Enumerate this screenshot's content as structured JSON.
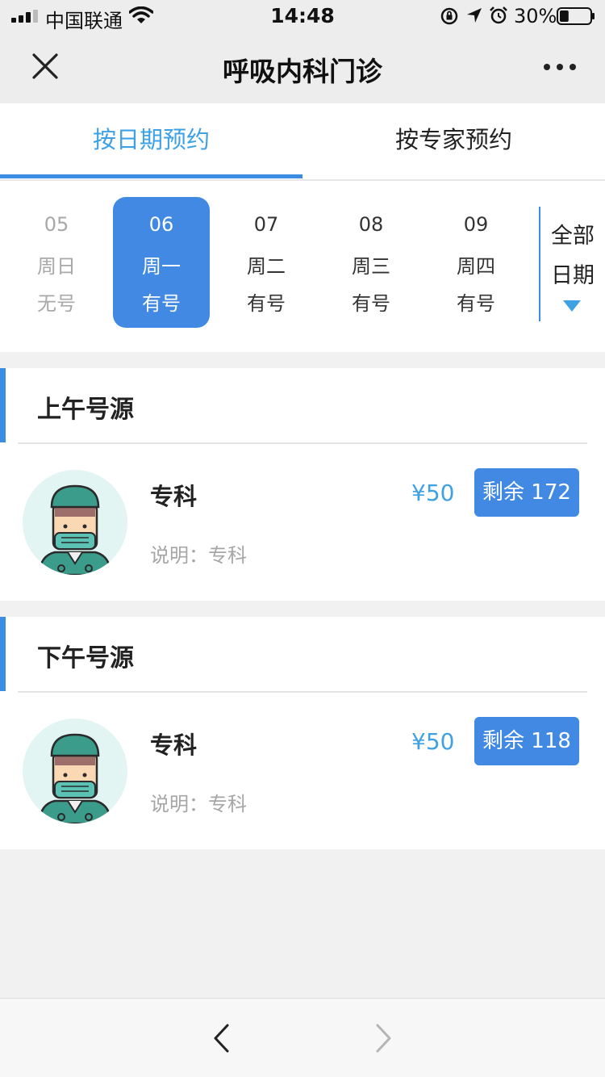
{
  "status_bar": {
    "carrier": "中国联通",
    "time": "14:48",
    "battery": "30%",
    "battery_level": 0.3
  },
  "nav": {
    "title": "呼吸内科门诊",
    "close_icon": "close-icon",
    "more_icon": "more-icon"
  },
  "tabs": [
    {
      "label": "按日期预约",
      "active": true
    },
    {
      "label": "按专家预约",
      "active": false
    }
  ],
  "dates": [
    {
      "date": "05",
      "weekday": "周日",
      "status": "无号",
      "state": "disabled"
    },
    {
      "date": "06",
      "weekday": "周一",
      "status": "有号",
      "state": "selected"
    },
    {
      "date": "07",
      "weekday": "周二",
      "status": "有号",
      "state": "normal"
    },
    {
      "date": "08",
      "weekday": "周三",
      "status": "有号",
      "state": "normal"
    },
    {
      "date": "09",
      "weekday": "周四",
      "status": "有号",
      "state": "normal"
    }
  ],
  "all_dates": {
    "line1": "全部",
    "line2": "日期"
  },
  "sections": [
    {
      "title": "上午号源",
      "item": {
        "name": "专科",
        "desc": "说明：专科",
        "price": "¥50",
        "remaining": "剩余 172"
      }
    },
    {
      "title": "下午号源",
      "item": {
        "name": "专科",
        "desc": "说明：专科",
        "price": "¥50",
        "remaining": "剩余 118"
      }
    }
  ],
  "colors": {
    "accent": "#3b8ce3",
    "accent_text": "#3ea1e4",
    "background": "#f1f1f1"
  }
}
